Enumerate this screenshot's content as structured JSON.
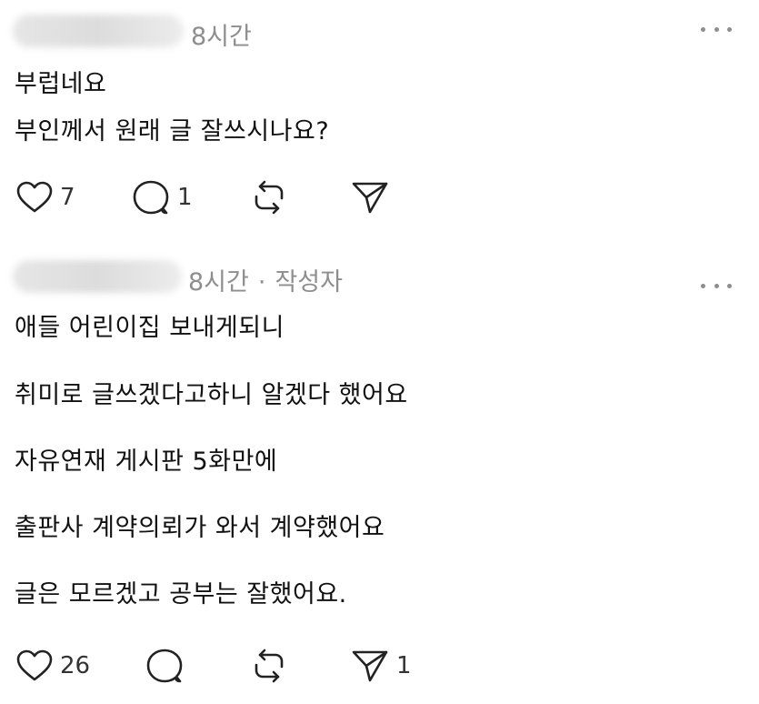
{
  "posts": [
    {
      "time": "8시간",
      "author_tag": "",
      "lines": [
        "부럽네요",
        "부인께서 원래 글 잘쓰시나요?"
      ],
      "actions": {
        "likes": "7",
        "replies": "1",
        "reposts": "",
        "shares": ""
      }
    },
    {
      "time": "8시간",
      "separator": "·",
      "author_tag": "작성자",
      "lines": [
        "애들 어린이집 보내게되니",
        "취미로 글쓰겠다고하니 알겠다 했어요",
        "자유연재 게시판 5화만에",
        "출판사 계약의뢰가 와서 계약했어요",
        "글은 모르겠고 공부는 잘했어요."
      ],
      "actions": {
        "likes": "26",
        "replies": "",
        "reposts": "",
        "shares": "1"
      }
    }
  ],
  "icons": {
    "like": "heart-icon",
    "reply": "speech-bubble-icon",
    "repost": "repost-arrows-icon",
    "share": "paper-plane-icon",
    "more": "more-dots-icon"
  },
  "colors": {
    "text": "#111111",
    "meta": "#8e8e8e",
    "icon": "#222222"
  }
}
